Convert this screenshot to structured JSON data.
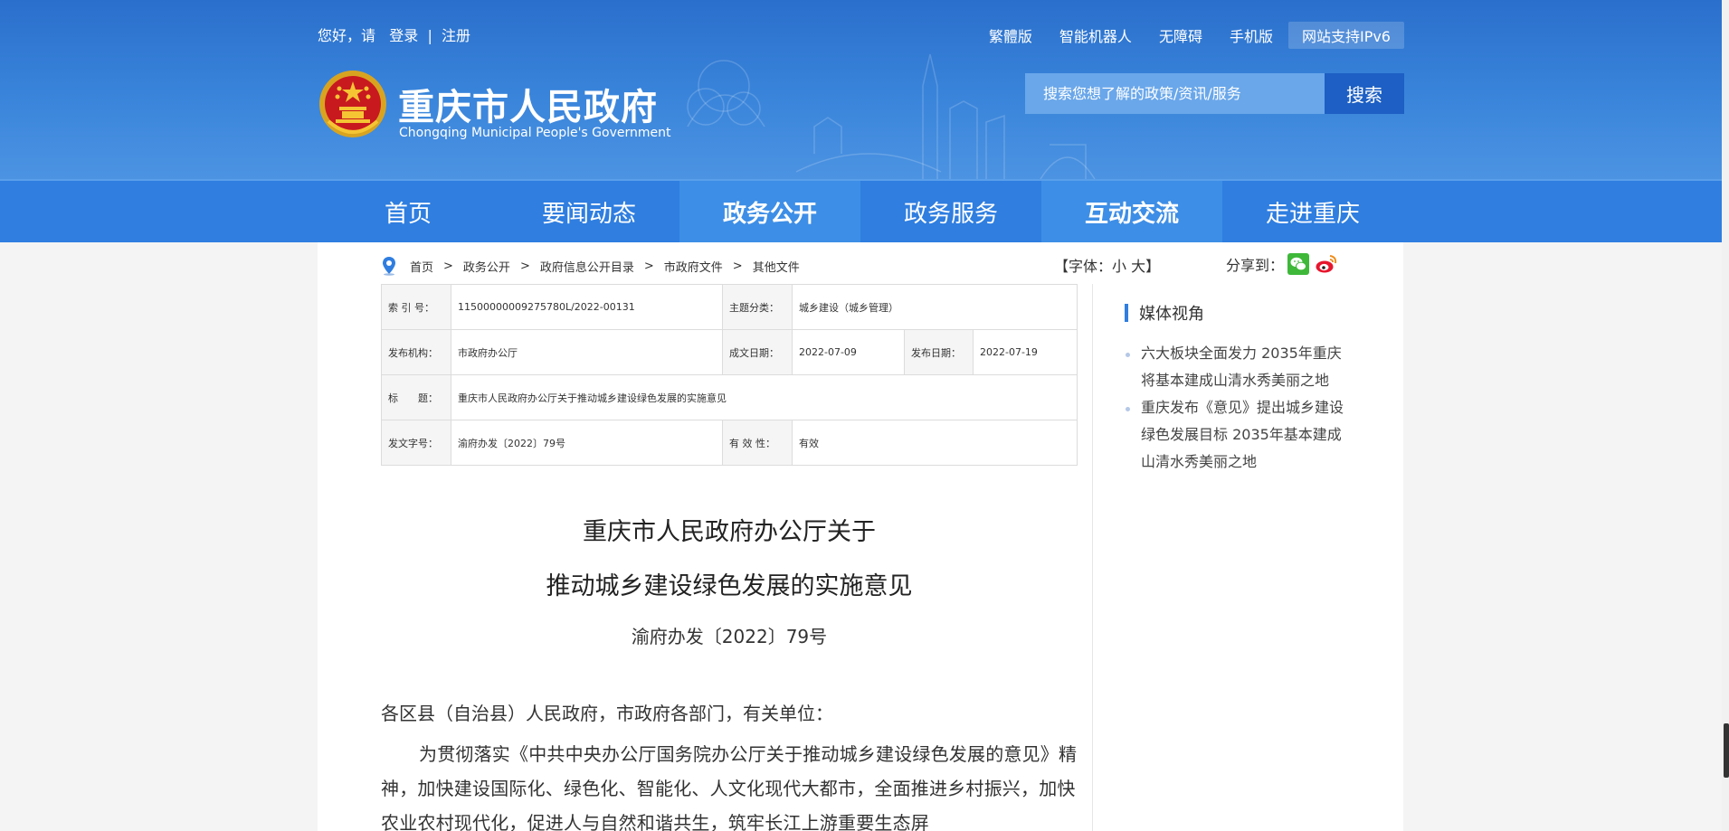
{
  "topbar": {
    "greeting": "您好，请",
    "login": "登录",
    "separator": "|",
    "register": "注册",
    "links": [
      "繁體版",
      "智能机器人",
      "无障碍",
      "手机版",
      "网站支持IPv6"
    ]
  },
  "site": {
    "title": "重庆市人民政府",
    "subtitle": "Chongqing Municipal People's Government"
  },
  "search": {
    "placeholder": "搜索您想了解的政策/资讯/服务",
    "button": "搜索"
  },
  "nav": {
    "items": [
      "首页",
      "要闻动态",
      "政务公开",
      "政务服务",
      "互动交流",
      "走进重庆"
    ],
    "active": [
      "政务公开",
      "互动交流"
    ]
  },
  "breadcrumb": {
    "items": [
      "首页",
      "政务公开",
      "政府信息公开目录",
      "市政府文件",
      "其他文件"
    ],
    "sep": ">"
  },
  "tools": {
    "fontsize": "【字体：小 大】",
    "share_label": "分享到："
  },
  "info": {
    "index_label": "索 引 号：",
    "index_value": "11500000009275780L/2022-00131",
    "category_label": "主题分类：",
    "category_value": "城乡建设（城乡管理）",
    "issuer_label": "发布机构：",
    "issuer_value": "市政府办公厅",
    "created_label": "成文日期：",
    "created_value": "2022-07-09",
    "published_label": "发布日期：",
    "published_value": "2022-07-19",
    "title_label": "标　　题：",
    "title_value": "重庆市人民政府办公厅关于推动城乡建设绿色发展的实施意见",
    "docno_label": "发文字号：",
    "docno_value": "渝府办发〔2022〕79号",
    "validity_label": "有 效 性：",
    "validity_value": "有效"
  },
  "document": {
    "title_line1": "重庆市人民政府办公厅关于",
    "title_line2": "推动城乡建设绿色发展的实施意见",
    "number": "渝府办发〔2022〕79号",
    "salutation": "各区县（自治县）人民政府，市政府各部门，有关单位：",
    "paragraph1": "为贯彻落实《中共中央办公厅国务院办公厅关于推动城乡建设绿色发展的意见》精神，加快建设国际化、绿色化、智能化、人文化现代大都市，全面推进乡村振兴，加快农业农村现代化，促进人与自然和谐共生，筑牢长江上游重要生态屏"
  },
  "sidebar": {
    "heading": "媒体视角",
    "items": [
      "六大板块全面发力 2035年重庆将基本建成山清水秀美丽之地",
      "重庆发布《意见》提出城乡建设绿色发展目标 2035年基本建成山清水秀美丽之地"
    ]
  },
  "colors": {
    "header_blue": "#3a85db",
    "nav_blue": "#2f7ee0",
    "nav_active": "#3d8ee6",
    "search_button": "#1d5fc4"
  }
}
